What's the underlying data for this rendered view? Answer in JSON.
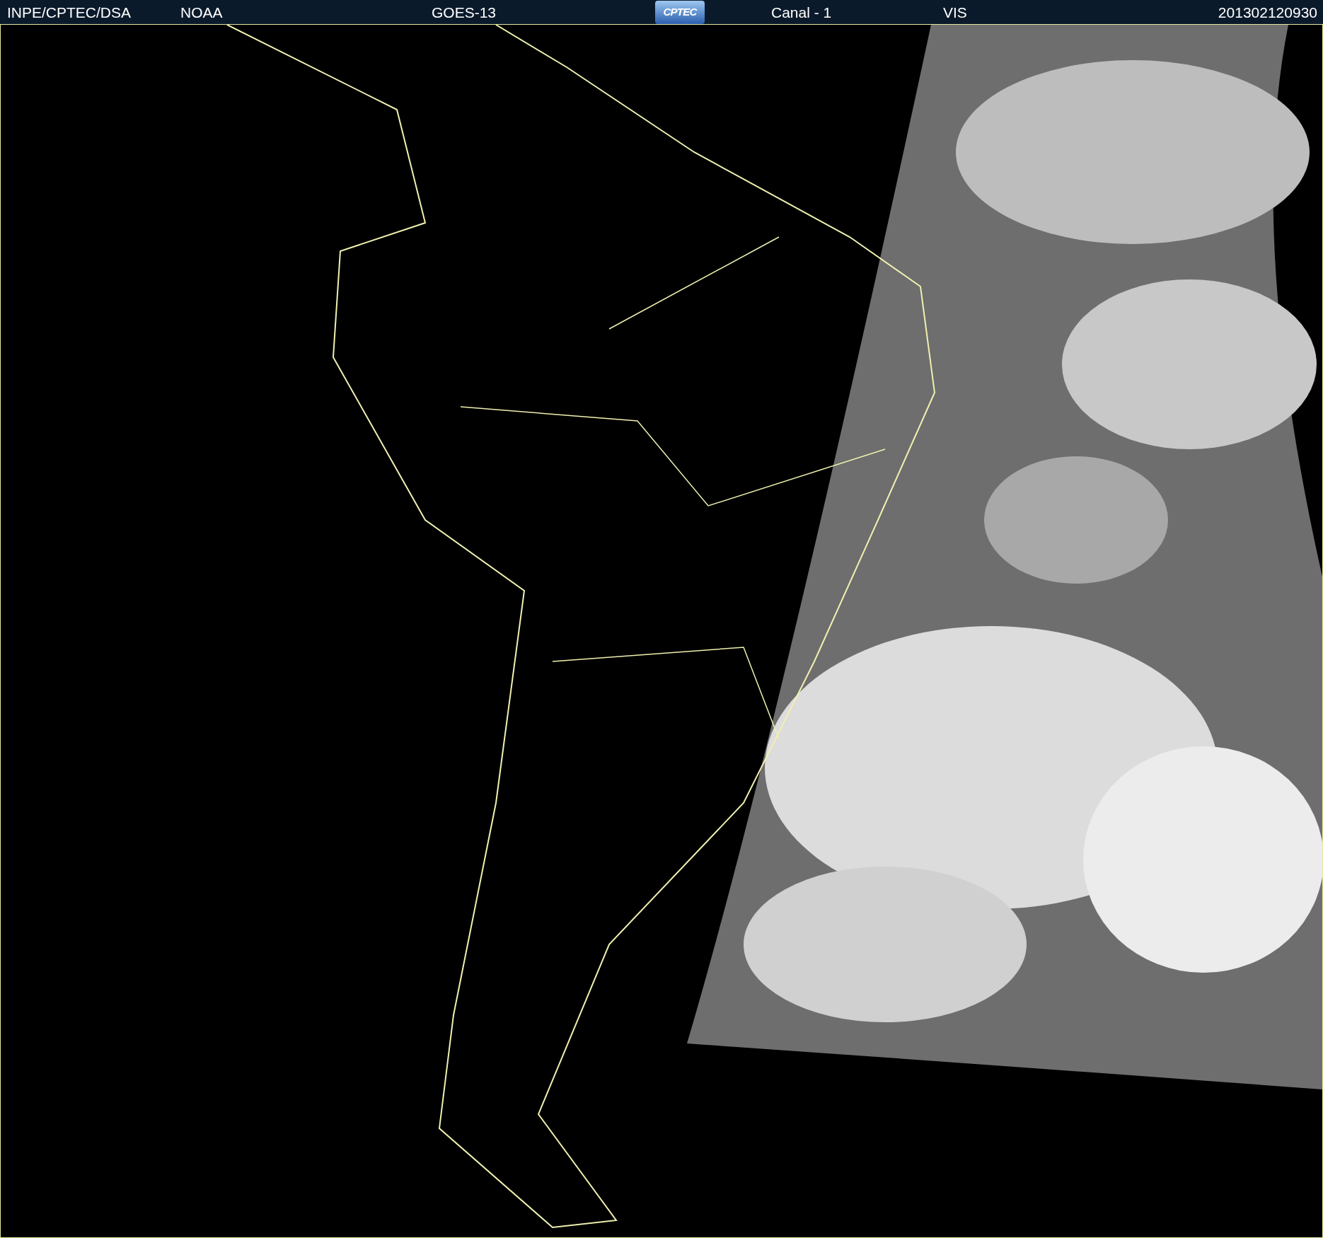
{
  "header": {
    "items": [
      {
        "kind": "text",
        "text": "INPE/CPTEC/DSA"
      },
      {
        "kind": "text",
        "text": "NOAA"
      },
      {
        "kind": "text",
        "text": "GOES-13"
      },
      {
        "kind": "logo",
        "text": "CPTEC"
      },
      {
        "kind": "text",
        "text": "Canal - 1"
      },
      {
        "kind": "text",
        "text": "VIS"
      },
      {
        "kind": "text",
        "text": "201302120930"
      }
    ]
  }
}
